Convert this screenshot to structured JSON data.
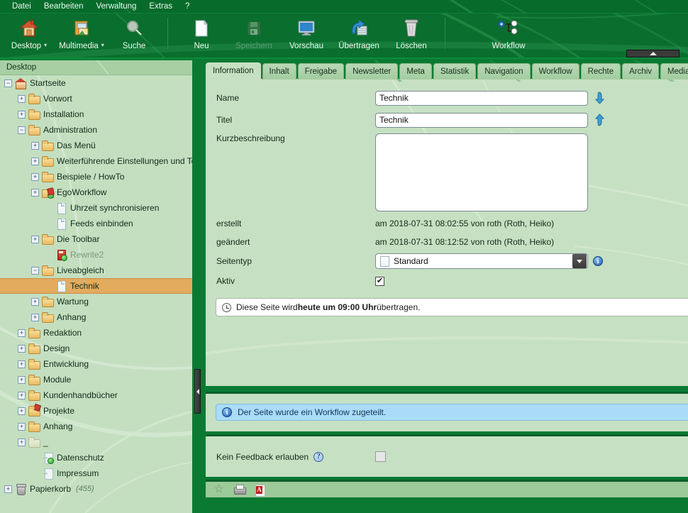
{
  "menubar": {
    "items": [
      {
        "label": "Datei"
      },
      {
        "label": "Bearbeiten"
      },
      {
        "label": "Verwaltung"
      },
      {
        "label": "Extras"
      },
      {
        "label": "?"
      }
    ]
  },
  "toolbar": {
    "items": [
      {
        "label": "Desktop",
        "icon": "home-icon",
        "dropdown": true,
        "disabled": false,
        "caret": "▾"
      },
      {
        "label": "Multimedia",
        "icon": "media-icon",
        "dropdown": true,
        "disabled": false,
        "caret": "▾"
      },
      {
        "label": "Suche",
        "icon": "search-icon",
        "dropdown": false,
        "disabled": false,
        "caret": ""
      },
      {
        "label": "Neu",
        "icon": "new-page-icon",
        "dropdown": false,
        "disabled": false,
        "caret": ""
      },
      {
        "label": "Speichern",
        "icon": "save-icon",
        "dropdown": false,
        "disabled": true,
        "caret": ""
      },
      {
        "label": "Vorschau",
        "icon": "preview-icon",
        "dropdown": false,
        "disabled": false,
        "caret": ""
      },
      {
        "label": "Übertragen",
        "icon": "publish-icon",
        "dropdown": false,
        "disabled": false,
        "caret": ""
      },
      {
        "label": "Löschen",
        "icon": "trash-icon",
        "dropdown": false,
        "disabled": false,
        "caret": ""
      },
      {
        "label": "Workflow",
        "icon": "workflow-icon",
        "dropdown": false,
        "disabled": false,
        "caret": ""
      }
    ]
  },
  "tree": {
    "header": "Desktop",
    "nodes": [
      {
        "label": "Startseite",
        "indent": 0,
        "toggle": "−",
        "icon": "home",
        "dim": false,
        "selected": false,
        "count": ""
      },
      {
        "label": "Vorwort",
        "indent": 1,
        "toggle": "+",
        "icon": "folder",
        "dim": false,
        "selected": false,
        "count": ""
      },
      {
        "label": "Installation",
        "indent": 1,
        "toggle": "+",
        "icon": "folder",
        "dim": false,
        "selected": false,
        "count": ""
      },
      {
        "label": "Administration",
        "indent": 1,
        "toggle": "−",
        "icon": "folder",
        "dim": false,
        "selected": false,
        "count": ""
      },
      {
        "label": "Das Menü",
        "indent": 2,
        "toggle": "+",
        "icon": "folder",
        "dim": false,
        "selected": false,
        "count": ""
      },
      {
        "label": "Weiterführende Einstellungen und To",
        "indent": 2,
        "toggle": "+",
        "icon": "folder",
        "dim": false,
        "selected": false,
        "count": ""
      },
      {
        "label": "Beispiele / HowTo",
        "indent": 2,
        "toggle": "+",
        "icon": "folder",
        "dim": false,
        "selected": false,
        "count": ""
      },
      {
        "label": "EgoWorkflow",
        "indent": 2,
        "toggle": "+",
        "icon": "gear",
        "dim": false,
        "selected": false,
        "count": ""
      },
      {
        "label": "Uhrzeit synchronisieren",
        "indent": 3,
        "toggle": "",
        "icon": "doc",
        "dim": false,
        "selected": false,
        "count": ""
      },
      {
        "label": "Feeds einbinden",
        "indent": 3,
        "toggle": "",
        "icon": "doc",
        "dim": false,
        "selected": false,
        "count": ""
      },
      {
        "label": "Die Toolbar",
        "indent": 2,
        "toggle": "+",
        "icon": "folder",
        "dim": false,
        "selected": false,
        "count": ""
      },
      {
        "label": "Rewrite2",
        "indent": 3,
        "toggle": "",
        "icon": "redbook",
        "dim": true,
        "selected": false,
        "count": ""
      },
      {
        "label": "Liveabgleich",
        "indent": 2,
        "toggle": "−",
        "icon": "folder",
        "dim": false,
        "selected": false,
        "count": ""
      },
      {
        "label": "Technik",
        "indent": 3,
        "toggle": "",
        "icon": "doc",
        "dim": false,
        "selected": true,
        "count": ""
      },
      {
        "label": "Wartung",
        "indent": 2,
        "toggle": "+",
        "icon": "folder",
        "dim": false,
        "selected": false,
        "count": ""
      },
      {
        "label": "Anhang",
        "indent": 2,
        "toggle": "+",
        "icon": "folder",
        "dim": false,
        "selected": false,
        "count": ""
      },
      {
        "label": "Redaktion",
        "indent": 1,
        "toggle": "+",
        "icon": "folder",
        "dim": false,
        "selected": false,
        "count": ""
      },
      {
        "label": "Design",
        "indent": 1,
        "toggle": "+",
        "icon": "folder",
        "dim": false,
        "selected": false,
        "count": ""
      },
      {
        "label": "Entwicklung",
        "indent": 1,
        "toggle": "+",
        "icon": "folder",
        "dim": false,
        "selected": false,
        "count": ""
      },
      {
        "label": "Module",
        "indent": 1,
        "toggle": "+",
        "icon": "folder",
        "dim": false,
        "selected": false,
        "count": ""
      },
      {
        "label": "Kundenhandbücher",
        "indent": 1,
        "toggle": "+",
        "icon": "folder",
        "dim": false,
        "selected": false,
        "count": ""
      },
      {
        "label": "Projekte",
        "indent": 1,
        "toggle": "+",
        "icon": "folderx",
        "dim": false,
        "selected": false,
        "count": ""
      },
      {
        "label": "Anhang",
        "indent": 1,
        "toggle": "+",
        "icon": "folder",
        "dim": false,
        "selected": false,
        "count": ""
      },
      {
        "label": "_",
        "indent": 1,
        "toggle": "+",
        "icon": "folderp",
        "dim": false,
        "selected": false,
        "count": ""
      },
      {
        "label": "Datenschutz",
        "indent": 2,
        "toggle": "",
        "icon": "linkok",
        "dim": false,
        "selected": false,
        "count": ""
      },
      {
        "label": "Impressum",
        "indent": 2,
        "toggle": "",
        "icon": "link",
        "dim": false,
        "selected": false,
        "count": ""
      },
      {
        "label": "Papierkorb",
        "indent": 0,
        "toggle": "+",
        "icon": "trash",
        "dim": false,
        "selected": false,
        "count": "(455)"
      }
    ]
  },
  "tabs": [
    {
      "label": "Information",
      "active": true
    },
    {
      "label": "Inhalt",
      "active": false
    },
    {
      "label": "Freigabe",
      "active": false
    },
    {
      "label": "Newsletter",
      "active": false
    },
    {
      "label": "Meta",
      "active": false
    },
    {
      "label": "Statistik",
      "active": false
    },
    {
      "label": "Navigation",
      "active": false
    },
    {
      "label": "Workflow",
      "active": false
    },
    {
      "label": "Rechte",
      "active": false
    },
    {
      "label": "Archiv",
      "active": false
    },
    {
      "label": "Media",
      "active": false
    }
  ],
  "form": {
    "name_label": "Name",
    "name_value": "Technik",
    "titel_label": "Titel",
    "titel_value": "Technik",
    "kurz_label": "Kurzbeschreibung",
    "kurz_value": "",
    "erstellt_label": "erstellt",
    "erstellt_value": "am 2018-07-31 08:02:55 von roth (Roth, Heiko)",
    "geaendert_label": "geändert",
    "geaendert_value": "am 2018-07-31 08:12:52 von roth (Roth, Heiko)",
    "seitentyp_label": "Seitentyp",
    "seitentyp_value": "Standard",
    "aktiv_label": "Aktiv",
    "aktiv_checked": "✔",
    "info_glyph": "i"
  },
  "notice": {
    "prefix": "Diese Seite wird ",
    "strong": "heute um 09:00 Uhr",
    "suffix": " übertragen."
  },
  "workflow_notice": {
    "text": "Der Seite wurde ein Workflow zugeteilt.",
    "icon_glyph": "i"
  },
  "feedback": {
    "label": "Kein Feedback erlauben",
    "help_glyph": "?",
    "checked": ""
  },
  "iconbar": {
    "items": [
      {
        "name": "favorite-icon",
        "glyph": "☆"
      },
      {
        "name": "print-icon",
        "glyph": ""
      },
      {
        "name": "pdf-icon",
        "glyph": ""
      }
    ]
  },
  "colors": {
    "chrome_green": "#0a7a33",
    "panel_green": "#c6e0c3",
    "tree_green": "#c3dfc0",
    "selection_orange": "#e3ab5e",
    "info_blue": "#aadcf7",
    "accent_blue": "#2f8fd0"
  }
}
